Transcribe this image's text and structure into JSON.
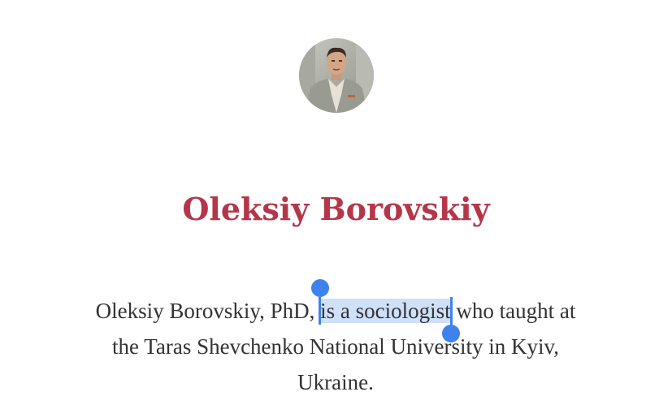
{
  "profile": {
    "name": "Oleksiy Borovskiy",
    "bio_before": "Oleksiy Borovskiy, PhD, ",
    "bio_selected": "is a sociologist",
    "bio_after": " who taught at the Taras Shevchenko National University in Kyiv, Ukraine."
  },
  "colors": {
    "name": "#b5364a",
    "body_text": "#333333",
    "selection": "#cfe0fa",
    "selection_handle": "#3f82ee"
  }
}
